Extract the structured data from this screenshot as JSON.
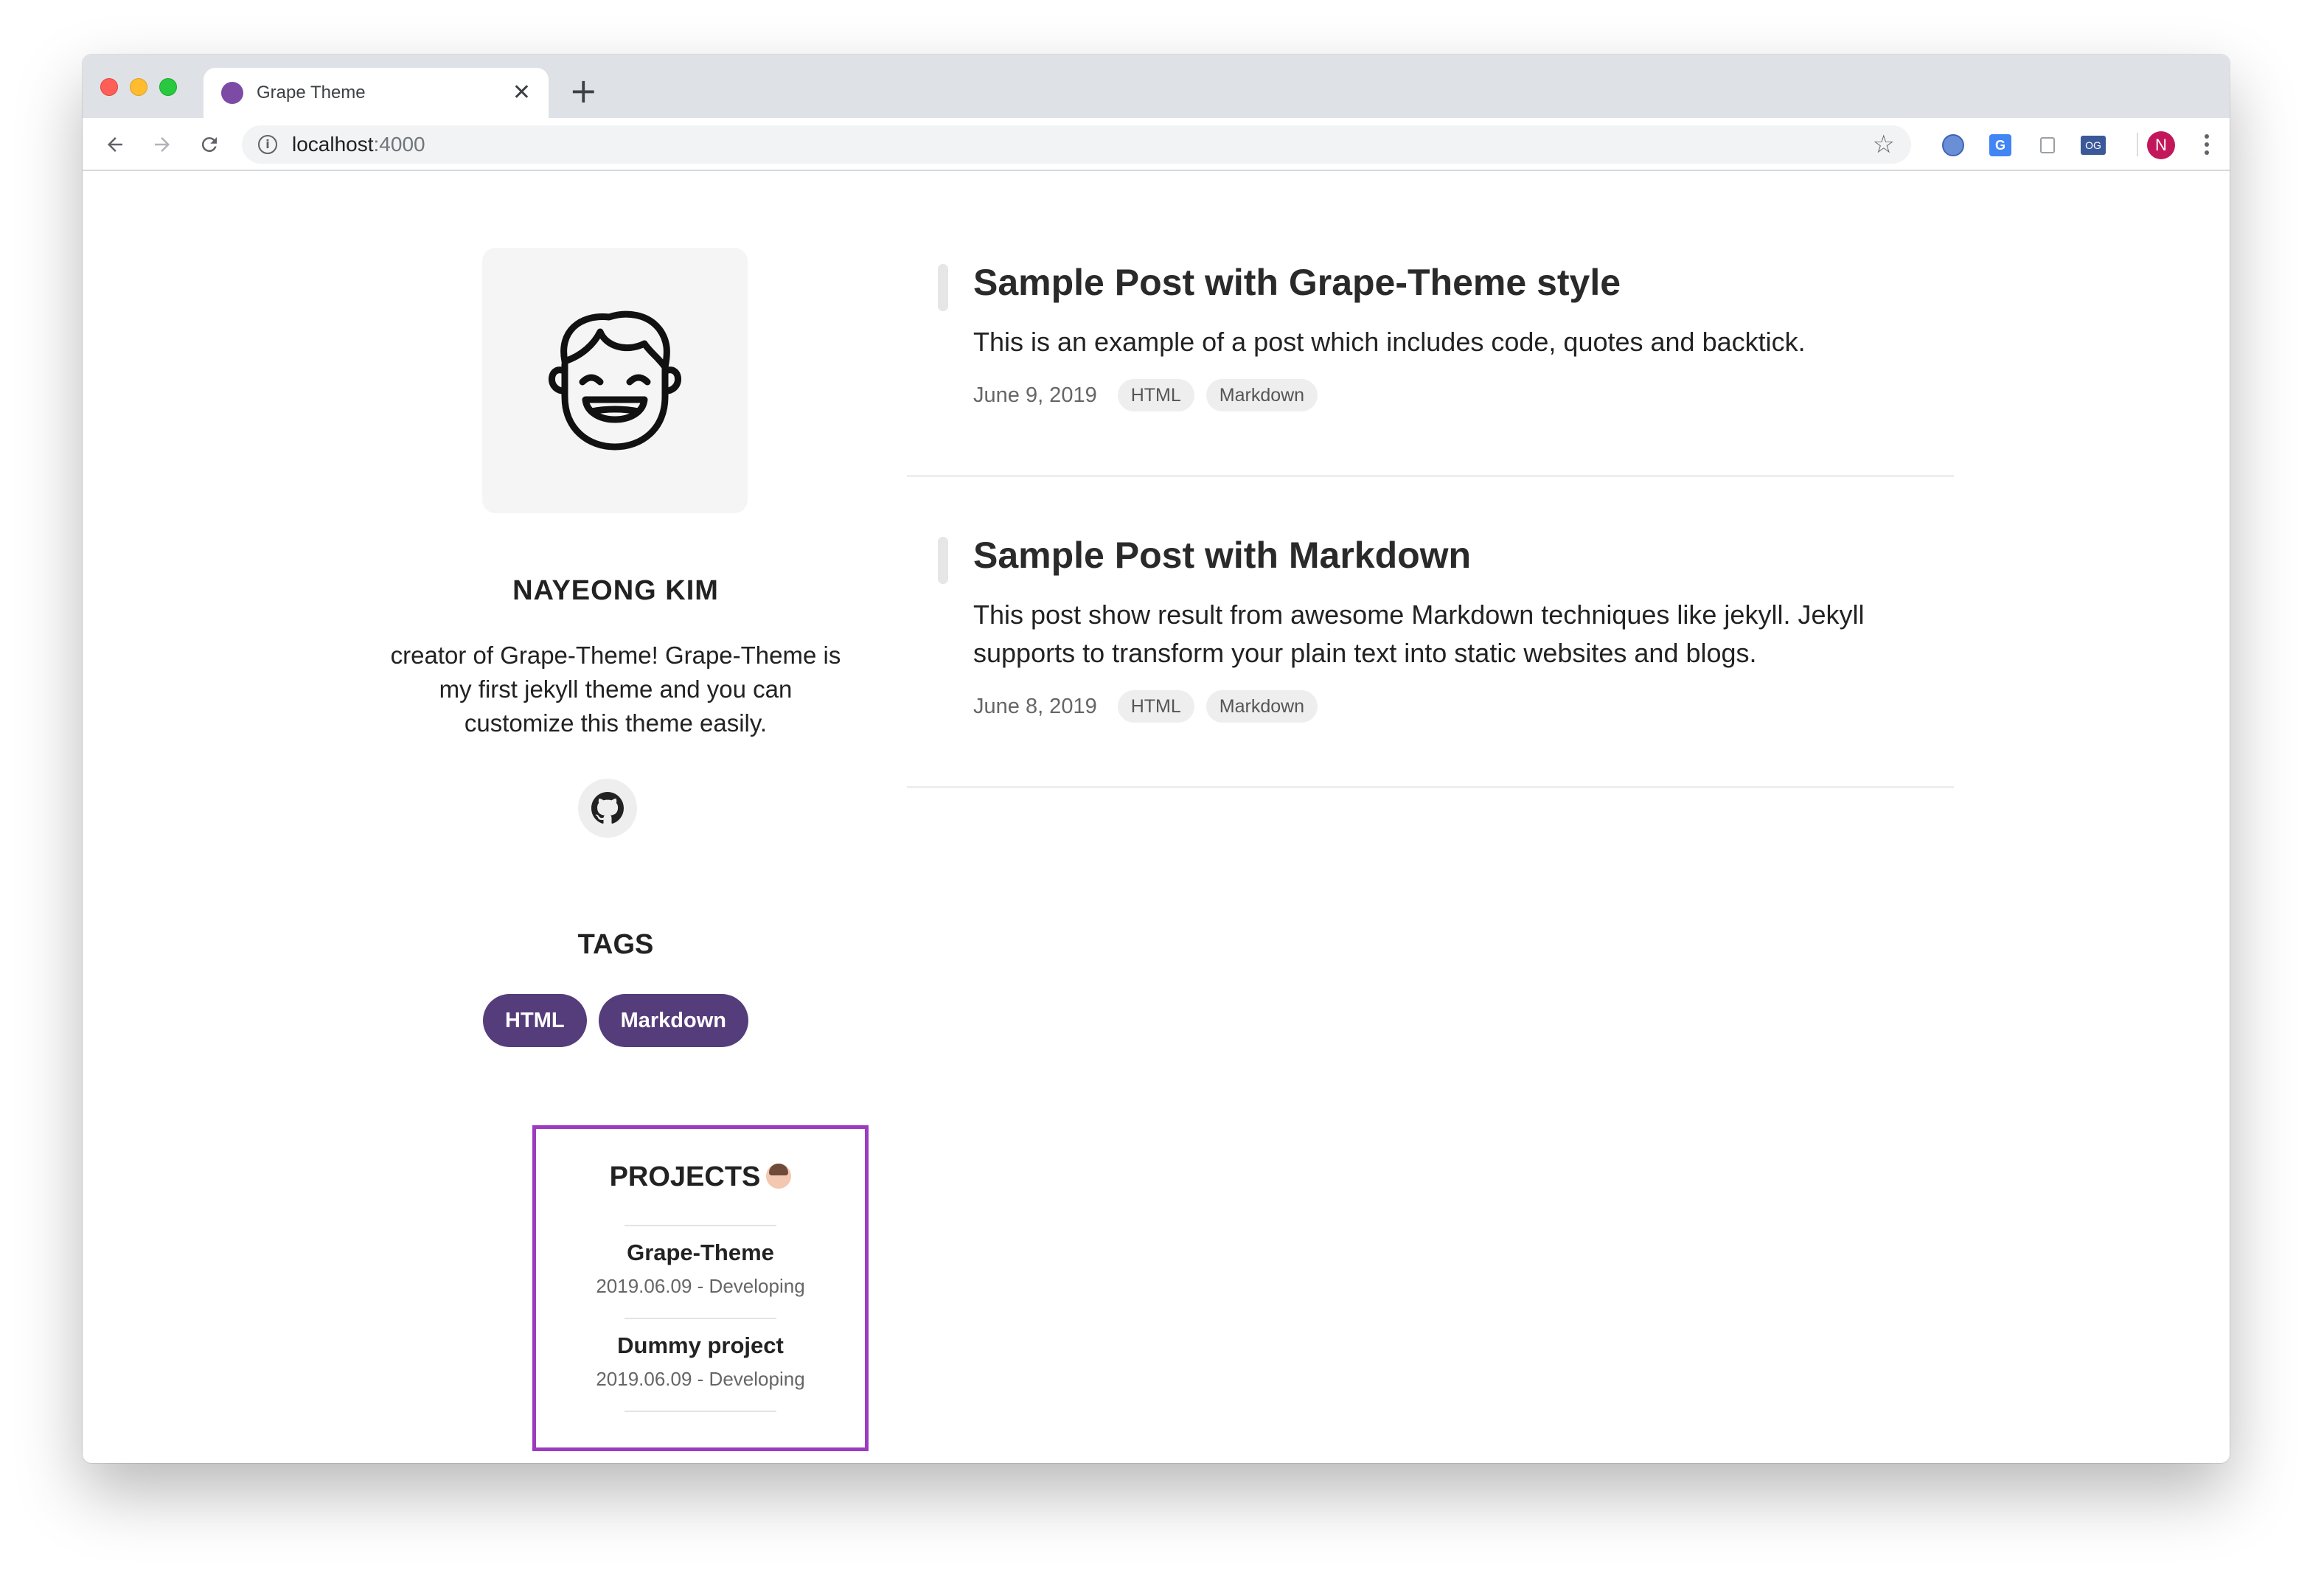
{
  "browser": {
    "tab_title": "Grape Theme",
    "tab_close": "✕",
    "new_tab": "+",
    "url_host": "localhost",
    "url_port": ":4000",
    "profile_initial": "N",
    "accent_favicon": "#7d4ba5",
    "icons": [
      "back-icon",
      "forward-icon",
      "reload-icon",
      "info-icon",
      "star-icon",
      "menu-icon"
    ]
  },
  "sidebar": {
    "author_name": "NAYEONG KIM",
    "bio": "creator of Grape-Theme! Grape-Theme is my first jekyll theme and you can customize this theme easily.",
    "tags_title": "TAGS",
    "tags": [
      {
        "label": "HTML"
      },
      {
        "label": "Markdown"
      }
    ],
    "tag_color": "#553c7b",
    "projects_title": "PROJECTS",
    "projects_border_color": "#9b3cc0",
    "projects": [
      {
        "name": "Grape-Theme",
        "date": "2019.06.09 - Developing"
      },
      {
        "name": "Dummy project",
        "date": "2019.06.09 - Developing"
      }
    ]
  },
  "posts": [
    {
      "title": "Sample Post with Grape-Theme style",
      "excerpt": "This is an example of a post which includes code, quotes and backtick.",
      "date": "June 9, 2019",
      "tags": [
        "HTML",
        "Markdown"
      ]
    },
    {
      "title": "Sample Post with Markdown",
      "excerpt": "This post show result from awesome Markdown techniques like jekyll. Jekyll supports to transform your plain text into static websites and blogs.",
      "date": "June 8, 2019",
      "tags": [
        "HTML",
        "Markdown"
      ]
    }
  ]
}
